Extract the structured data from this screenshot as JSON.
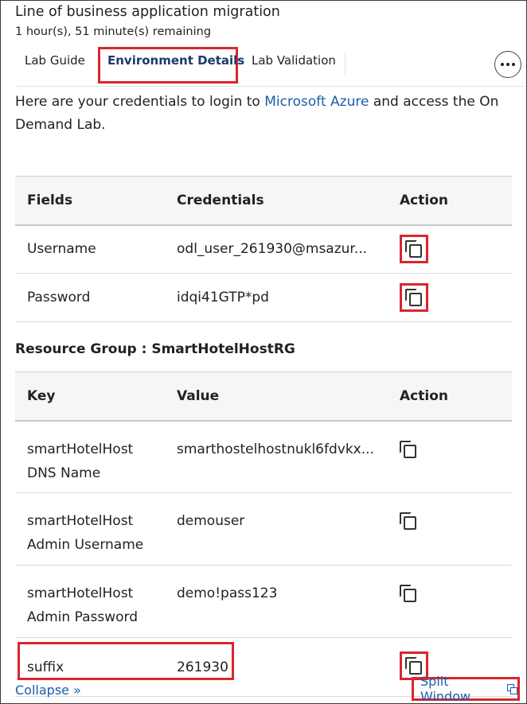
{
  "header": {
    "lab_title": "Line of business application migration",
    "time_remaining": "1 hour(s), 51 minute(s) remaining"
  },
  "tabs": [
    {
      "label": "Lab Guide",
      "active": false
    },
    {
      "label": "Environment Details",
      "active": true
    },
    {
      "label": "Lab Validation",
      "active": false
    }
  ],
  "intro": {
    "before": "Here are your credentials to login to ",
    "link": "Microsoft Azure",
    "after": " and access the On Demand Lab."
  },
  "credentials": {
    "headers": [
      "Fields",
      "Credentials",
      "Action"
    ],
    "rows": [
      {
        "field": "Username",
        "value": "odl_user_261930@msazur..."
      },
      {
        "field": "Password",
        "value": "idqi41GTP*pd"
      }
    ]
  },
  "resource_group": {
    "heading": "Resource Group : SmartHotelHostRG",
    "headers": [
      "Key",
      "Value",
      "Action"
    ],
    "rows": [
      {
        "key_line1": "smartHotelHost",
        "key_line2": "DNS Name",
        "value": "smarthostelhostnukl6fdvkx..."
      },
      {
        "key_line1": "smartHotelHost",
        "key_line2": "Admin Username",
        "value": "demouser"
      },
      {
        "key_line1": "smartHotelHost",
        "key_line2": "Admin Password",
        "value": "demo!pass123"
      },
      {
        "key_line1": "suffix",
        "key_line2": "",
        "value": "261930"
      }
    ]
  },
  "footer": {
    "collapse": "Collapse »",
    "split_window": "Split Window"
  },
  "colors": {
    "highlight": "#d9262e",
    "link": "#1a5fa8",
    "active_tab": "#1b3a6b"
  },
  "icons": [
    "copy-icon",
    "more-icon",
    "split-window-icon"
  ]
}
